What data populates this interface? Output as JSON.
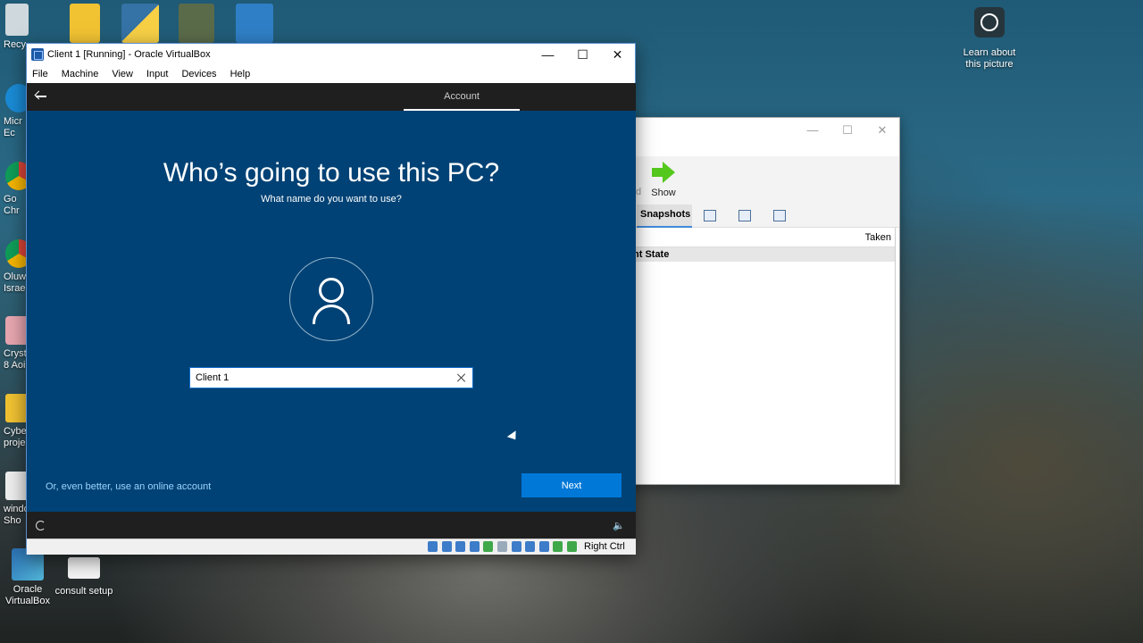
{
  "desktop": {
    "top_icons": [
      {
        "name": "recycle-bin-icon",
        "label": "Recy",
        "color": "#cfd8dc"
      },
      {
        "name": "documents-folder-icon",
        "label": "",
        "color": "#f1c232"
      },
      {
        "name": "python-icon",
        "label": "",
        "color": "#3572a5"
      },
      {
        "name": "photo-file-icon",
        "label": "",
        "color": "#5a6b4a"
      },
      {
        "name": "chatgpt-icon",
        "label": "",
        "color": "#2f7fc6"
      }
    ],
    "side_icons": [
      {
        "name": "microsoft-edge-icon",
        "line1": "Micr",
        "line2": "Ec",
        "color": "#1a8bd6"
      },
      {
        "name": "google-chrome-icon",
        "line1": "Go",
        "line2": "Chr",
        "color": "#db4437"
      },
      {
        "name": "chrome-profile-icon",
        "line1": "Oluw",
        "line2": "Israe",
        "color": "#34a853"
      },
      {
        "name": "crystal-app-icon",
        "line1": "Crysta",
        "line2": "8 Aoi",
        "color": "#e8a6b0"
      },
      {
        "name": "folder-icon",
        "line1": "Cyber",
        "line2": "proje",
        "color": "#f1c232"
      },
      {
        "name": "shortcut-file-icon",
        "line1": "windo",
        "line2": "Sho",
        "color": "#eeeeee"
      }
    ],
    "bottom_icons": [
      {
        "name": "virtualbox-icon",
        "label": "Oracle VirtualBox"
      },
      {
        "name": "consult-setup-icon",
        "label": "consult setup"
      }
    ],
    "learn_about": "Learn about this picture"
  },
  "manager": {
    "show_label": "Show",
    "partial_label": "d",
    "snapshots_tab": "Snapshots",
    "taken_header": "Taken",
    "current_state": "nt State"
  },
  "vm_window": {
    "title": "Client 1 [Running] - Oracle VirtualBox",
    "menu": [
      "File",
      "Machine",
      "View",
      "Input",
      "Devices",
      "Help"
    ],
    "host_key": "Right Ctrl"
  },
  "oobe": {
    "tab_label": "Account",
    "heading": "Who’s going to use this PC?",
    "subheading": "What name do you want to use?",
    "name_value": "Client 1",
    "online_link": "Or, even better, use an online account",
    "next_label": "Next"
  },
  "colors": {
    "oobe_background": "#004275",
    "accent_button": "#0078d7",
    "link": "#9cd4ff"
  }
}
